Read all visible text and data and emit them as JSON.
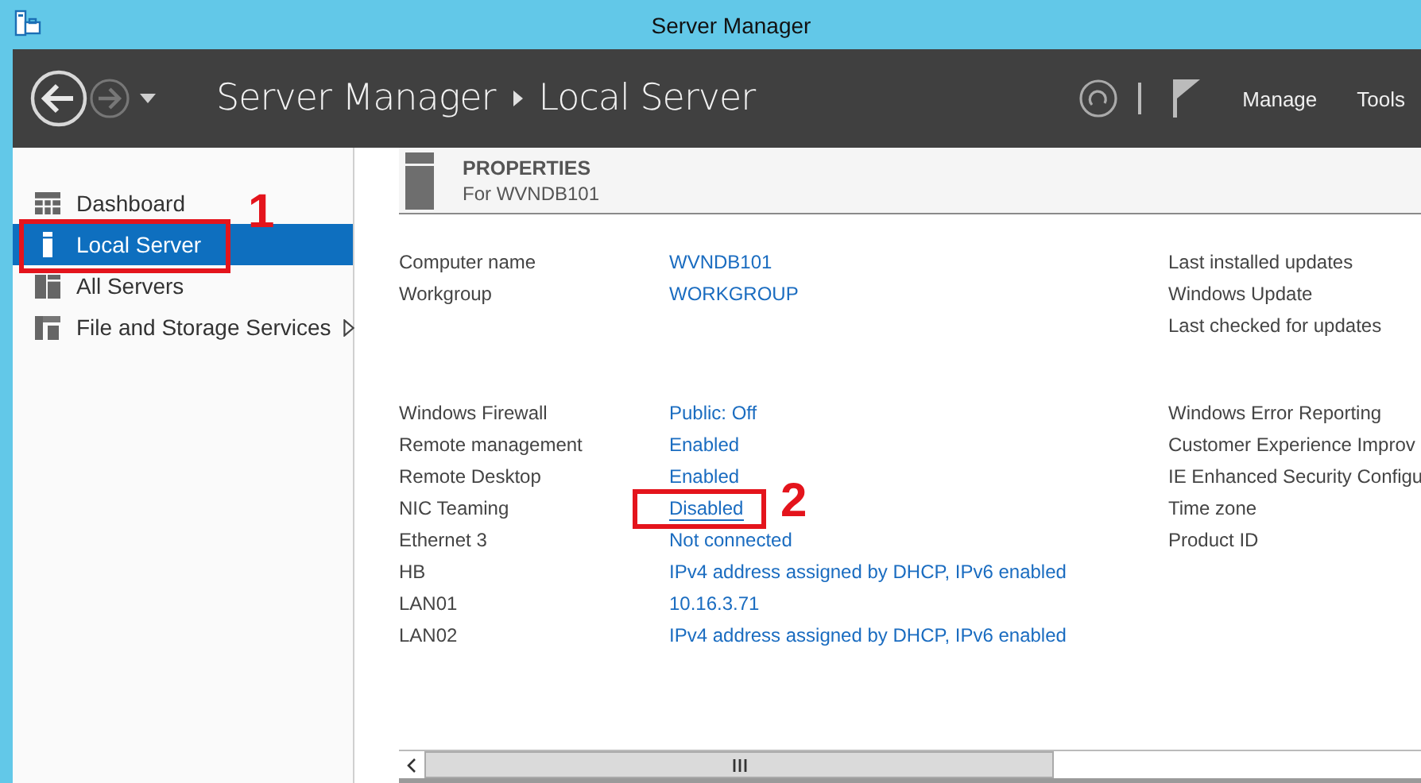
{
  "window": {
    "title": "Server Manager"
  },
  "header": {
    "breadcrumb": [
      "Server Manager",
      "Local Server"
    ],
    "menus": [
      "Manage",
      "Tools"
    ]
  },
  "sidebar": {
    "items": [
      {
        "label": "Dashboard",
        "kind": "dashboard",
        "selected": false,
        "expandable": false
      },
      {
        "label": "Local Server",
        "kind": "server",
        "selected": true,
        "expandable": false,
        "callout": "1"
      },
      {
        "label": "All Servers",
        "kind": "servers",
        "selected": false,
        "expandable": false
      },
      {
        "label": "File and Storage Services",
        "kind": "storage",
        "selected": false,
        "expandable": true
      }
    ]
  },
  "properties": {
    "title": "PROPERTIES",
    "subtitle": "For WVNDB101",
    "groups": [
      {
        "left": [
          {
            "label": "Computer name",
            "value": "WVNDB101",
            "underlined": false
          },
          {
            "label": "Workgroup",
            "value": "WORKGROUP",
            "underlined": false
          }
        ],
        "right": [
          {
            "label": "Last installed updates"
          },
          {
            "label": "Windows Update"
          },
          {
            "label": "Last checked for updates"
          }
        ]
      },
      {
        "left": [
          {
            "label": "Windows Firewall",
            "value": "Public: Off",
            "underlined": false
          },
          {
            "label": "Remote management",
            "value": "Enabled",
            "underlined": false
          },
          {
            "label": "Remote Desktop",
            "value": "Enabled",
            "underlined": false
          },
          {
            "label": "NIC Teaming",
            "value": "Disabled",
            "underlined": true,
            "callout": "2"
          },
          {
            "label": "Ethernet 3",
            "value": "Not connected",
            "underlined": false
          },
          {
            "label": "HB",
            "value": "IPv4 address assigned by DHCP, IPv6 enabled",
            "underlined": false
          },
          {
            "label": "LAN01",
            "value": "10.16.3.71",
            "underlined": false
          },
          {
            "label": "LAN02",
            "value": "IPv4 address assigned by DHCP, IPv6 enabled",
            "underlined": false
          }
        ],
        "right": [
          {
            "label": "Windows Error Reporting"
          },
          {
            "label": "Customer Experience Improv"
          },
          {
            "label": "IE Enhanced Security Configu"
          },
          {
            "label": "Time zone"
          },
          {
            "label": "Product ID"
          }
        ]
      }
    ]
  }
}
